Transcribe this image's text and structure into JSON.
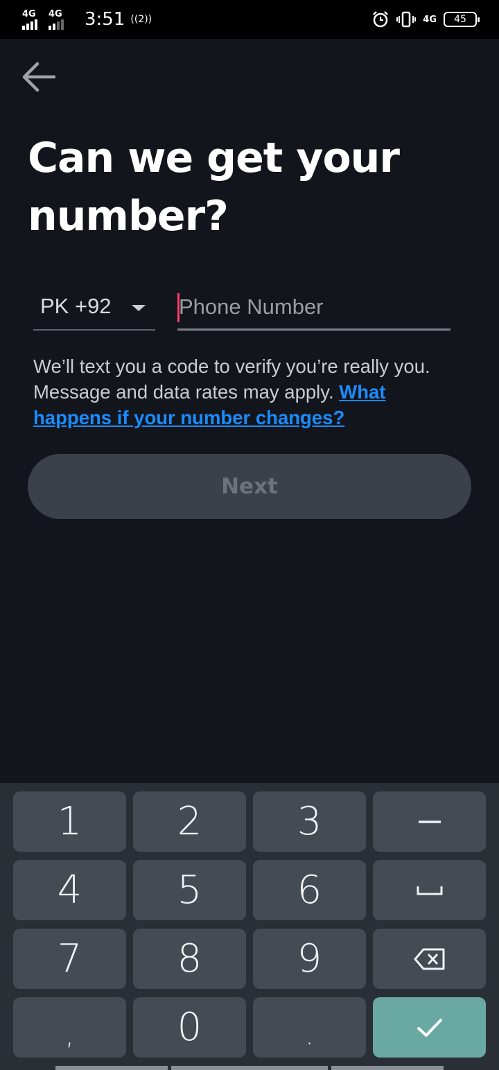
{
  "status_bar": {
    "sim1_label": "4G",
    "sim2_label": "4G",
    "time": "3:51",
    "hotspot_label": "((2))",
    "network_label": "4G",
    "battery_level": "45"
  },
  "header": {
    "back_icon": "arrow-left-icon",
    "title": "Can we get your number?"
  },
  "form": {
    "country_code": "PK +92",
    "phone_placeholder": "Phone Number",
    "phone_value": ""
  },
  "info": {
    "text": "We’ll text you a code to verify you’re really you. Message and data rates may apply. ",
    "link": "What happens if your number changes?"
  },
  "next_button": {
    "label": "Next"
  },
  "keyboard": {
    "rows": [
      [
        "1",
        "2",
        "3",
        "–"
      ],
      [
        "4",
        "5",
        "6",
        "␣"
      ],
      [
        "7",
        "8",
        "9",
        "⌫"
      ],
      [
        ",",
        "0",
        ".",
        "✓"
      ]
    ],
    "accent": "#6aa9a3"
  },
  "colors": {
    "background": "#12151b",
    "link": "#1a8cff",
    "cursor": "#ff3b6b",
    "button_disabled": "#3b414b"
  }
}
